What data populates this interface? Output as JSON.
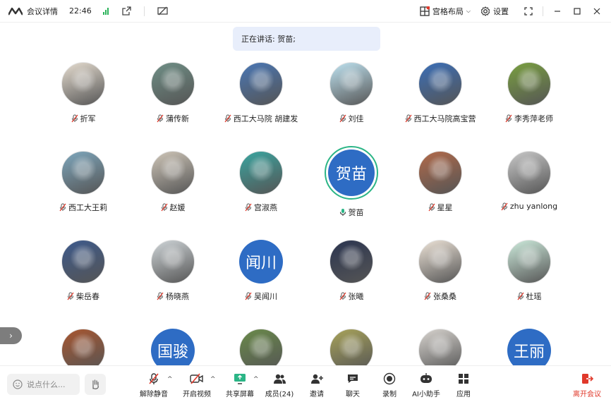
{
  "titlebar": {
    "title": "会议详情",
    "time": "22:46",
    "layout_label": "宫格布局",
    "settings_label": "设置"
  },
  "speaking_banner": "正在讲话: 贺苗;",
  "participants": [
    {
      "name": "折军",
      "avatar": "photo",
      "color": "#e6ddd0"
    },
    {
      "name": "蒲传新",
      "avatar": "photo",
      "color": "#6f8f86"
    },
    {
      "name": "西工大马院 胡建发",
      "avatar": "photo",
      "color": "#4a77b5"
    },
    {
      "name": "刘佳",
      "avatar": "photo",
      "color": "#bfe3f1"
    },
    {
      "name": "西工大马院高宝营",
      "avatar": "photo",
      "color": "#3b6fb8"
    },
    {
      "name": "李秀萍老师",
      "avatar": "photo",
      "color": "#7aa040"
    },
    {
      "name": "西工大王莉",
      "avatar": "photo",
      "color": "#7ea7bd"
    },
    {
      "name": "赵媛",
      "avatar": "photo",
      "color": "#cfc6b8"
    },
    {
      "name": "宫淑燕",
      "avatar": "photo",
      "color": "#3aa5a0"
    },
    {
      "name": "贺苗",
      "avatar": "text",
      "text": "贺苗",
      "active": true
    },
    {
      "name": "星星",
      "avatar": "photo",
      "color": "#b26a4a"
    },
    {
      "name": "zhu yanlong",
      "avatar": "photo",
      "color": "#c9c9c9"
    },
    {
      "name": "柴岳春",
      "avatar": "photo",
      "color": "#3d5a8c"
    },
    {
      "name": "杨晓燕",
      "avatar": "photo",
      "color": "#cfd5d8"
    },
    {
      "name": "吴闻川",
      "avatar": "text",
      "text": "闻川"
    },
    {
      "name": "张曦",
      "avatar": "photo",
      "color": "#2b3550"
    },
    {
      "name": "张桑桑",
      "avatar": "photo",
      "color": "#ede3d7"
    },
    {
      "name": "杜瑶",
      "avatar": "photo",
      "color": "#cdebdc"
    },
    {
      "name": "",
      "avatar": "photo",
      "color": "#a85630"
    },
    {
      "name": "",
      "avatar": "text",
      "text": "国骏"
    },
    {
      "name": "",
      "avatar": "photo",
      "color": "#6a8a4a"
    },
    {
      "name": "",
      "avatar": "photo",
      "color": "#a8a35a"
    },
    {
      "name": "",
      "avatar": "photo",
      "color": "#d8d4cf"
    },
    {
      "name": "",
      "avatar": "text",
      "text": "王丽"
    }
  ],
  "toolbar": {
    "input_placeholder": "说点什么...",
    "unmute": "解除静音",
    "video": "开启视频",
    "share": "共享屏幕",
    "members": "成员(24)",
    "invite": "邀请",
    "chat": "聊天",
    "record": "录制",
    "ai": "AI小助手",
    "apps": "应用",
    "leave": "离开会议"
  },
  "colors": {
    "accent": "#2e6cc4",
    "active_ring": "#2bb586",
    "leave": "#e0392b",
    "signal": "#2bb35a"
  }
}
